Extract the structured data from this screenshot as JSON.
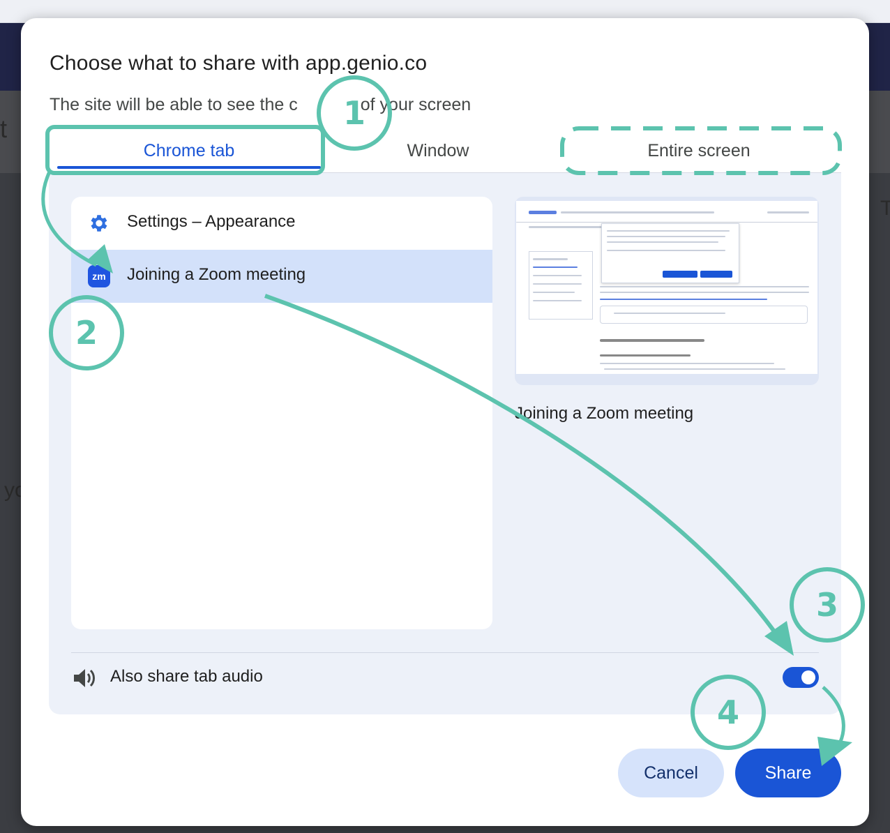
{
  "background": {
    "edge_chars": [
      "t",
      "yo",
      "T"
    ]
  },
  "dialog": {
    "title": "Choose what to share with app.genio.co",
    "subtitle": "The site will be able to see the contents of your screen",
    "subtitle_visible_start": "The site will be able to see the c",
    "subtitle_visible_end": "of your screen",
    "tabs": [
      {
        "label": "Chrome tab",
        "selected": true
      },
      {
        "label": "Window",
        "selected": false
      },
      {
        "label": "Entire screen",
        "selected": false
      }
    ],
    "tab_list": [
      {
        "label": "Settings – Appearance",
        "icon": "gear-icon",
        "selected": false
      },
      {
        "label": "Joining a Zoom meeting",
        "icon": "zoom-icon",
        "icon_text": "zm",
        "selected": true
      }
    ],
    "preview_caption": "Joining a Zoom meeting",
    "audio_label": "Also share tab audio",
    "audio_enabled": true,
    "cancel_label": "Cancel",
    "share_label": "Share"
  },
  "annotations": {
    "step_numbers": [
      "1",
      "2",
      "3",
      "4"
    ],
    "color": "#5cc3ae"
  },
  "colors": {
    "accent": "#1a55d6",
    "selected_row": "#d3e1fa",
    "panel": "#edf1f9",
    "cancel_bg": "#d6e3fb"
  }
}
